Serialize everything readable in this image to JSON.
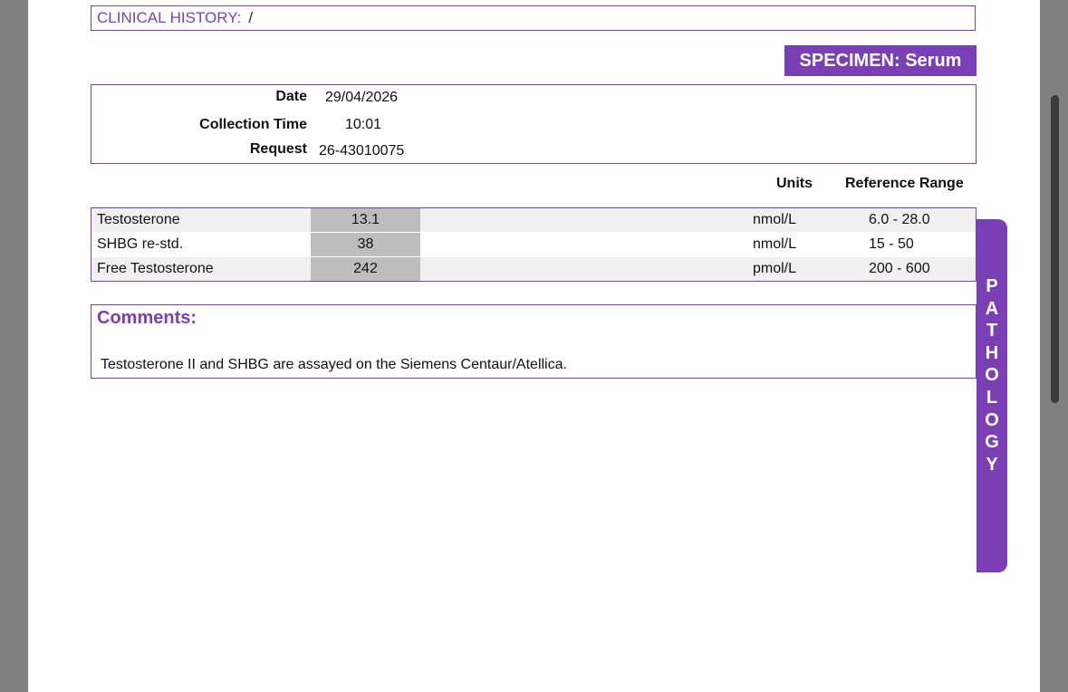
{
  "clinical_history": {
    "label": "CLINICAL HISTORY:",
    "value": "/"
  },
  "specimen": {
    "label": "SPECIMEN: Serum"
  },
  "info": {
    "date_label": "Date",
    "date_value": "29/04/2026",
    "collection_label": "Collection Time",
    "collection_value": "10:01",
    "request_label": "Request",
    "request_value": "26-43010075"
  },
  "results_header": {
    "units": "Units",
    "reference_range": "Reference Range"
  },
  "results": [
    {
      "name": "Testosterone",
      "value": "13.1",
      "units": "nmol/L",
      "range": "6.0 - 28.0"
    },
    {
      "name": "SHBG re-std.",
      "value": "38",
      "units": "nmol/L",
      "range": "15 - 50"
    },
    {
      "name": "Free Testosterone",
      "value": "242",
      "units": "pmol/L",
      "range": "200 - 600"
    }
  ],
  "comments": {
    "title": "Comments:",
    "text": "Testosterone II and SHBG are assayed on the Siemens Centaur/Atellica."
  },
  "side_tab": {
    "letters": [
      "P",
      "A",
      "T",
      "H",
      "O",
      "L",
      "O",
      "G",
      "Y"
    ]
  },
  "colors": {
    "accent": "#7a3fb5",
    "value_cell": "#bdbdbd",
    "row_shade": "#f0f0f0",
    "viewer_background": "#808080"
  }
}
